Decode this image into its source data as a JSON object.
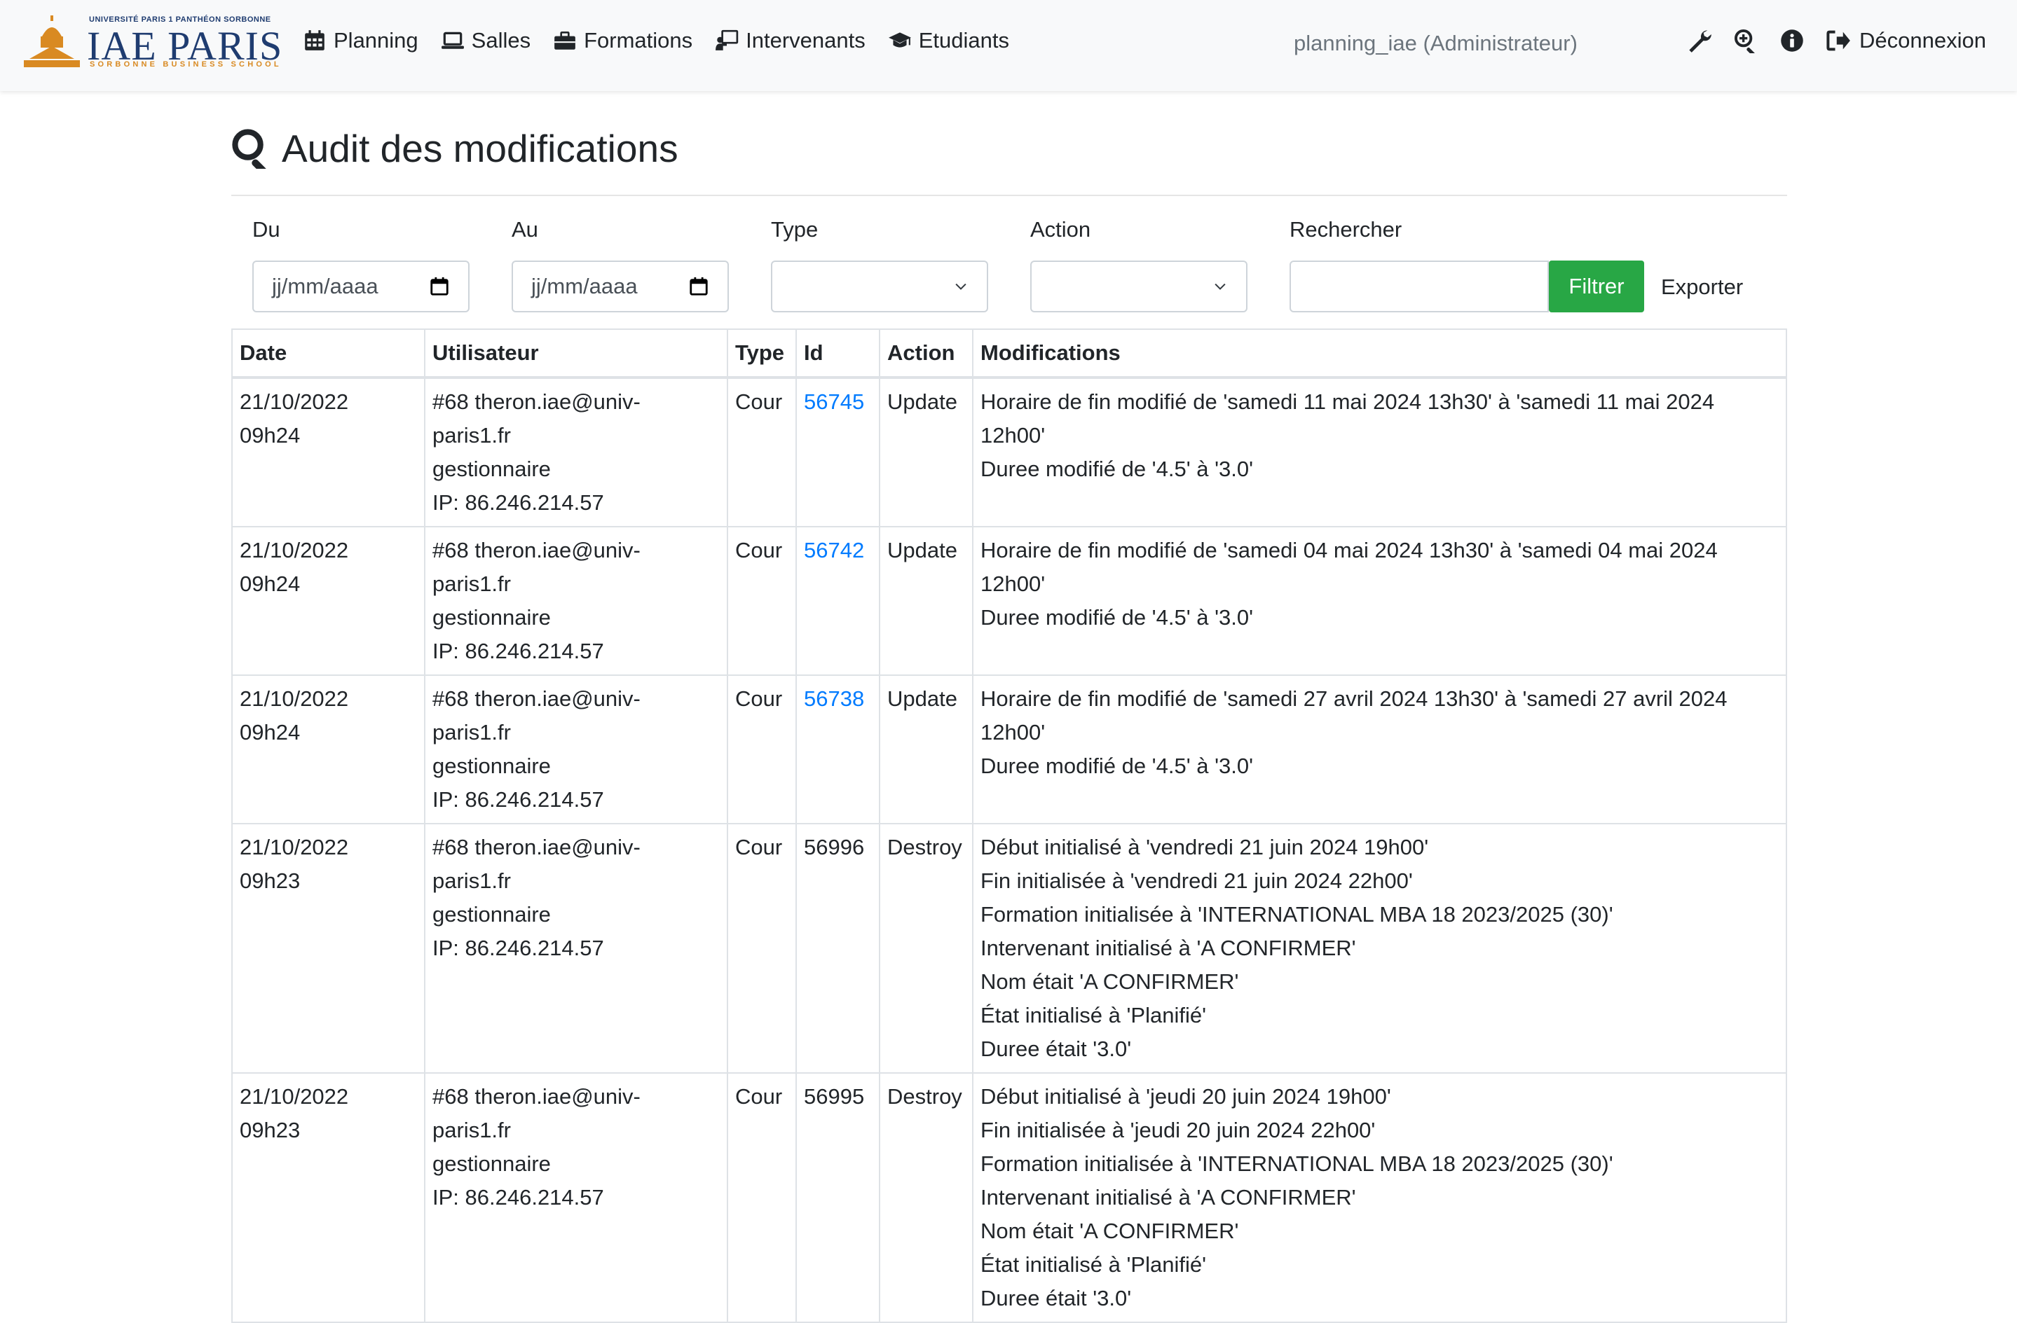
{
  "logo": {
    "university": "UNIVERSITÉ PARIS 1 PANTHÉON SORBONNE",
    "brand": "IAE PARIS",
    "school": "SORBONNE BUSINESS SCHOOL",
    "accent_color": "#d98a22",
    "brand_color": "#1f3c70"
  },
  "nav": {
    "items": [
      {
        "label": "Planning",
        "icon": "calendar-icon"
      },
      {
        "label": "Salles",
        "icon": "laptop-icon"
      },
      {
        "label": "Formations",
        "icon": "briefcase-icon"
      },
      {
        "label": "Intervenants",
        "icon": "chalkboard-teacher-icon"
      },
      {
        "label": "Etudiants",
        "icon": "graduation-cap-icon"
      }
    ],
    "user": "planning_iae (Administrateur)",
    "logout_label": "Déconnexion",
    "right_icons": [
      "wrench-icon",
      "search-plus-icon",
      "info-circle-icon"
    ]
  },
  "page": {
    "title": "Audit des modifications"
  },
  "filters": {
    "du_label": "Du",
    "du_placeholder": "jj/mm/aaaa",
    "au_label": "Au",
    "au_placeholder": "jj/mm/aaaa",
    "type_label": "Type",
    "type_value": "",
    "action_label": "Action",
    "action_value": "",
    "search_label": "Rechercher",
    "search_value": "",
    "filter_button": "Filtrer",
    "export_label": "Exporter",
    "filter_button_color": "#28a745"
  },
  "table": {
    "headers": [
      "Date",
      "Utilisateur",
      "Type",
      "Id",
      "Action",
      "Modifications"
    ],
    "rows": [
      {
        "date": "21/10/2022",
        "time": "09h24",
        "user": "#68 theron.iae@univ-",
        "user2": "paris1.fr",
        "role": "gestionnaire",
        "ip": "IP: 86.246.214.57",
        "type": "Cour",
        "id": "56745",
        "id_link": true,
        "action": "Update",
        "mods": [
          "Horaire de fin modifié de 'samedi 11 mai 2024 13h30' à 'samedi 11 mai 2024",
          "12h00'",
          "Duree modifié de '4.5' à '3.0'"
        ]
      },
      {
        "date": "21/10/2022",
        "time": "09h24",
        "user": "#68 theron.iae@univ-",
        "user2": "paris1.fr",
        "role": "gestionnaire",
        "ip": "IP: 86.246.214.57",
        "type": "Cour",
        "id": "56742",
        "id_link": true,
        "action": "Update",
        "mods": [
          "Horaire de fin modifié de 'samedi 04 mai 2024 13h30' à 'samedi 04 mai 2024",
          "12h00'",
          "Duree modifié de '4.5' à '3.0'"
        ]
      },
      {
        "date": "21/10/2022",
        "time": "09h24",
        "user": "#68 theron.iae@univ-",
        "user2": "paris1.fr",
        "role": "gestionnaire",
        "ip": "IP: 86.246.214.57",
        "type": "Cour",
        "id": "56738",
        "id_link": true,
        "action": "Update",
        "mods": [
          "Horaire de fin modifié de 'samedi 27 avril 2024 13h30' à 'samedi 27 avril 2024",
          "12h00'",
          "Duree modifié de '4.5' à '3.0'"
        ]
      },
      {
        "date": "21/10/2022",
        "time": "09h23",
        "user": "#68 theron.iae@univ-",
        "user2": "paris1.fr",
        "role": "gestionnaire",
        "ip": "IP: 86.246.214.57",
        "type": "Cour",
        "id": "56996",
        "id_link": false,
        "action": "Destroy",
        "mods": [
          "Début initialisé à 'vendredi 21 juin 2024 19h00'",
          "Fin initialisée à 'vendredi 21 juin 2024 22h00'",
          "Formation initialisée à 'INTERNATIONAL MBA 18 2023/2025 (30)'",
          "Intervenant initialisé à 'A CONFIRMER'",
          "Nom était 'A CONFIRMER'",
          "État initialisé à 'Planifié'",
          "Duree était '3.0'"
        ]
      },
      {
        "date": "21/10/2022",
        "time": "09h23",
        "user": "#68 theron.iae@univ-",
        "user2": "paris1.fr",
        "role": "gestionnaire",
        "ip": "IP: 86.246.214.57",
        "type": "Cour",
        "id": "56995",
        "id_link": false,
        "action": "Destroy",
        "mods": [
          "Début initialisé à 'jeudi 20 juin 2024 19h00'",
          "Fin initialisée à 'jeudi 20 juin 2024 22h00'",
          "Formation initialisée à 'INTERNATIONAL MBA 18 2023/2025 (30)'",
          "Intervenant initialisé à 'A CONFIRMER'",
          "Nom était 'A CONFIRMER'",
          "État initialisé à 'Planifié'",
          "Duree était '3.0'"
        ]
      }
    ]
  }
}
